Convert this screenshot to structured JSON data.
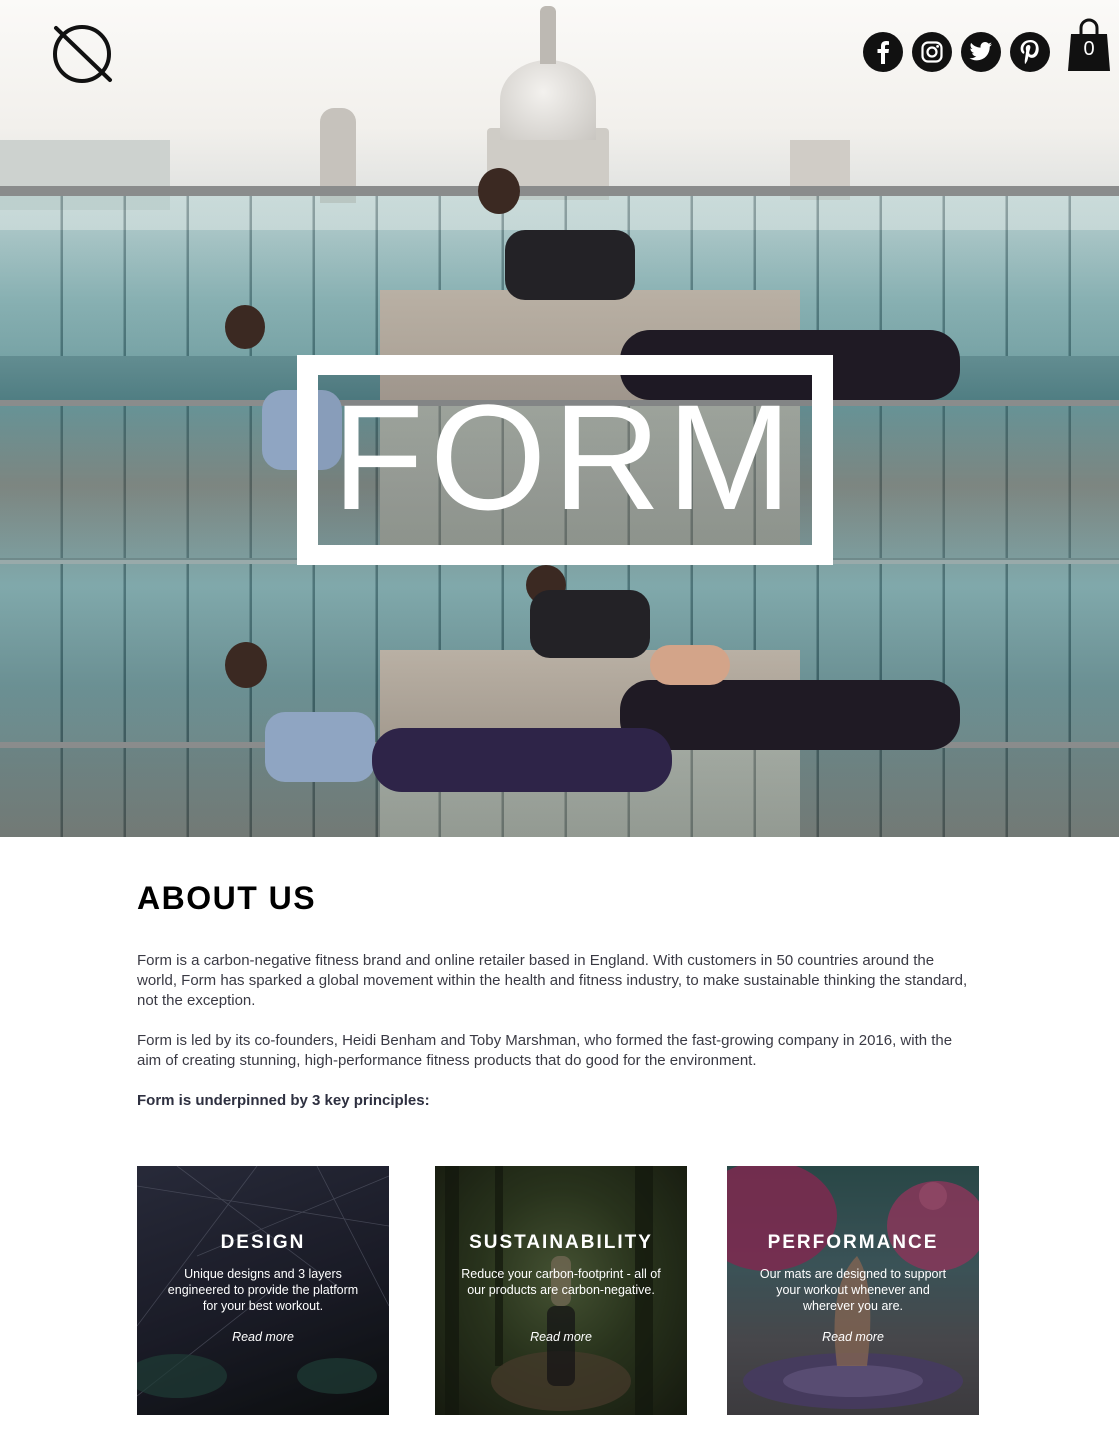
{
  "header": {
    "logo_icon": "planet-logo-icon",
    "social": [
      {
        "name": "facebook",
        "icon": "facebook-icon"
      },
      {
        "name": "instagram",
        "icon": "instagram-icon"
      },
      {
        "name": "twitter",
        "icon": "twitter-icon"
      },
      {
        "name": "pinterest",
        "icon": "pinterest-icon"
      }
    ],
    "cart": {
      "icon": "shopping-bag-icon",
      "count": "0"
    }
  },
  "hero": {
    "title": "FORM"
  },
  "about": {
    "heading": "ABOUT US",
    "paragraph_1": "Form is a carbon-negative fitness brand and online retailer based in England. With customers in 50 countries around the world, Form has sparked a global movement within the health and fitness industry, to make sustainable thinking the standard, not the exception.",
    "paragraph_2": "Form is led by its co-founders, Heidi Benham and Toby Marshman, who formed the fast-growing company in 2016, with the aim of creating stunning, high-performance fitness products that do good for the environment.",
    "principles_intro": "Form is underpinned by 3 key principles:"
  },
  "cards": [
    {
      "title": "DESIGN",
      "text": "Unique designs and 3 layers engineered to provide the platform for your best workout.",
      "link": "Read more"
    },
    {
      "title": "SUSTAINABILITY",
      "text": "Reduce your carbon-footprint - all of our products are carbon-negative.",
      "link": "Read more"
    },
    {
      "title": "PERFORMANCE",
      "text": "Our mats are designed to support your workout whenever and wherever you are.",
      "link": "Read more"
    }
  ],
  "colors": {
    "text_dark": "#2b2b33",
    "heading": "#000000",
    "icon_bg": "#111111",
    "white": "#ffffff"
  }
}
